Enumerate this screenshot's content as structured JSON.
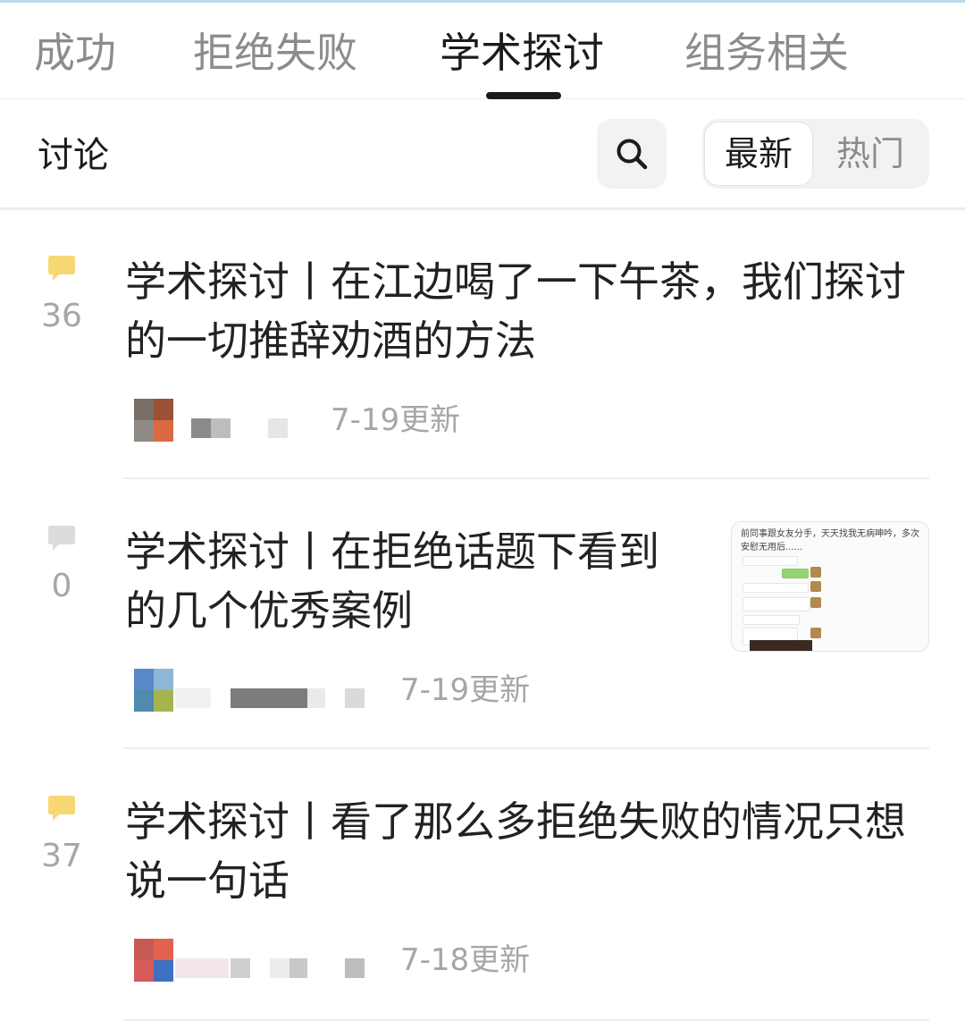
{
  "tabs": [
    {
      "label": "成功",
      "active": false
    },
    {
      "label": "拒绝失败",
      "active": false
    },
    {
      "label": "学术探讨",
      "active": true
    },
    {
      "label": "组务相关",
      "active": false
    }
  ],
  "filter": {
    "label": "讨论",
    "search_icon": "search-icon",
    "sort_options": [
      "最新",
      "热门"
    ],
    "selected_sort": "最新"
  },
  "posts": [
    {
      "comment_icon": "comment-bubble-icon",
      "comment_count": "36",
      "title": "学术探讨丨在江边喝了一下午茶，我们探讨的一切推辞劝酒的方法",
      "date": "7-19更新",
      "has_thumbnail": false
    },
    {
      "comment_icon": "comment-bubble-icon",
      "comment_count": "0",
      "title": "学术探讨丨在拒绝话题下看到的几个优秀案例",
      "date": "7-19更新",
      "has_thumbnail": true,
      "thumbnail_text": "前同事跟女友分手，天天找我无病呻吟，多次安慰无用后......"
    },
    {
      "comment_icon": "comment-bubble-icon",
      "comment_count": "37",
      "title": "学术探讨丨看了那么多拒绝失败的情况只想说一句话",
      "date": "7-18更新",
      "has_thumbnail": false
    }
  ],
  "colors": {
    "active_text": "#1b1b1b",
    "inactive_text": "#8c8c8c",
    "comment_active": "#f7d774",
    "comment_empty": "#dcdcdc",
    "meta_text": "#a6a6a6"
  }
}
